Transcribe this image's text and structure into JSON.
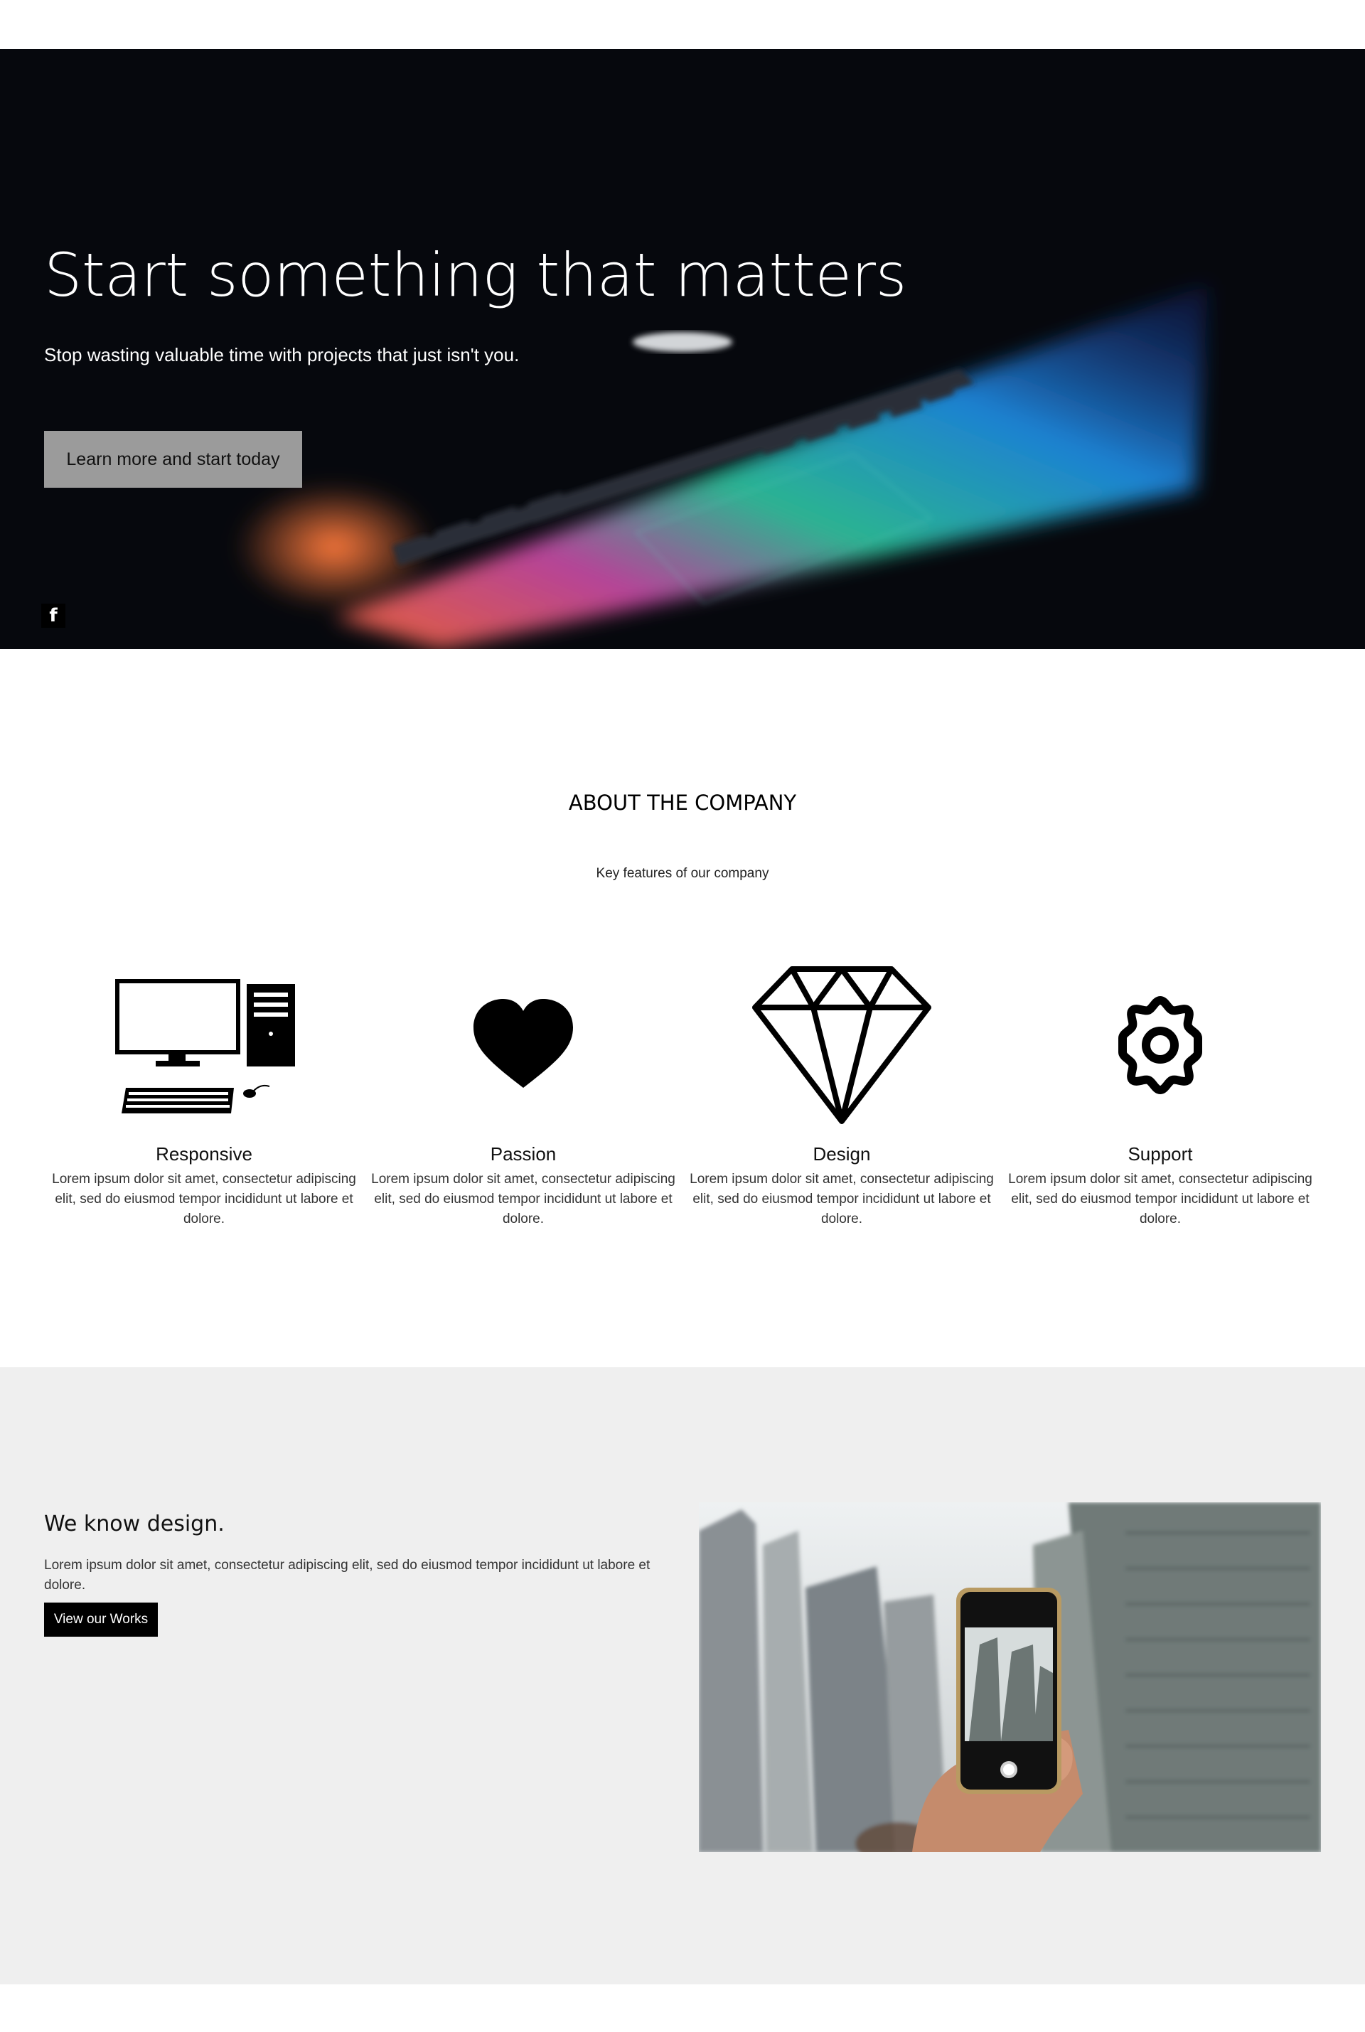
{
  "hero": {
    "title": "Start something that matters",
    "subtitle": "Stop wasting valuable time with projects that just isn't you.",
    "cta_label": "Learn more and start today",
    "social_icon": "facebook-icon",
    "social_glyph": "f"
  },
  "about": {
    "title": "ABOUT THE COMPANY",
    "subtitle": "Key features of our company",
    "features": [
      {
        "icon": "desktop-computer-icon",
        "title": "Responsive",
        "text": "Lorem ipsum dolor sit amet, consectetur adipiscing elit, sed do eiusmod tempor incididunt ut labore et dolore."
      },
      {
        "icon": "heart-icon",
        "title": "Passion",
        "text": "Lorem ipsum dolor sit amet, consectetur adipiscing elit, sed do eiusmod tempor incididunt ut labore et dolore."
      },
      {
        "icon": "diamond-icon",
        "title": "Design",
        "text": "Lorem ipsum dolor sit amet, consectetur adipiscing elit, sed do eiusmod tempor incididunt ut labore et dolore."
      },
      {
        "icon": "gear-icon",
        "title": "Support",
        "text": "Lorem ipsum dolor sit amet, consectetur adipiscing elit, sed do eiusmod tempor incididunt ut labore et dolore."
      }
    ]
  },
  "design_section": {
    "title": "We know design.",
    "text": "Lorem ipsum dolor sit amet, consectetur adipiscing elit, sed do eiusmod tempor incididunt ut labore et dolore.",
    "button_label": "View our Works",
    "image": "hand-holding-phone-photographing-buildings"
  },
  "colors": {
    "hero_bg": "#06080d",
    "cta_bg": "#9b9b9b",
    "section_bg": "#efefef",
    "button_bg": "#000000"
  }
}
